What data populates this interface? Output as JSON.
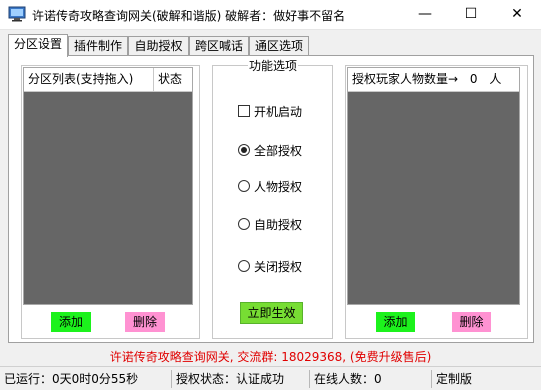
{
  "window": {
    "title": "许诺传奇攻略查询网关(破解和谐版)  破解者：做好事不留名",
    "minimize_glyph": "—",
    "maximize_glyph": "☐",
    "close_glyph": "✕",
    "icon": "monitor-icon"
  },
  "tabs": [
    {
      "label": "分区设置",
      "active": true
    },
    {
      "label": "插件制作"
    },
    {
      "label": "自助授权"
    },
    {
      "label": "跨区喊话"
    },
    {
      "label": "通区选项"
    }
  ],
  "partition_panel": {
    "columns": [
      "分区列表(支持拖入)",
      "状态"
    ],
    "add_label": "添加",
    "delete_label": "删除"
  },
  "function_panel": {
    "legend": "功能选项",
    "autostart_label": "开机启动",
    "autostart_checked": false,
    "options": [
      {
        "label": "全部授权",
        "checked": true
      },
      {
        "label": "人物授权",
        "checked": false
      },
      {
        "label": "自助授权",
        "checked": false
      },
      {
        "label": "关闭授权",
        "checked": false
      }
    ],
    "apply_label": "立即生效"
  },
  "auth_panel": {
    "header_prefix": "授权玩家人物数量→",
    "count": "0",
    "unit": "人",
    "add_label": "添加",
    "delete_label": "删除"
  },
  "notice": "许诺传奇攻略查询网关, 交流群: 18029368, (免费升级售后)",
  "status": {
    "uptime": "已运行：0天0时0分55秒",
    "auth_state": "授权状态：认证成功",
    "online": "在线人数：0",
    "edition": "定制版"
  },
  "colors": {
    "add_button": "#1cf21c",
    "delete_button": "#ff92d2",
    "apply_button": "#77dd33",
    "notice_text": "#e00000",
    "list_background": "#666666"
  }
}
